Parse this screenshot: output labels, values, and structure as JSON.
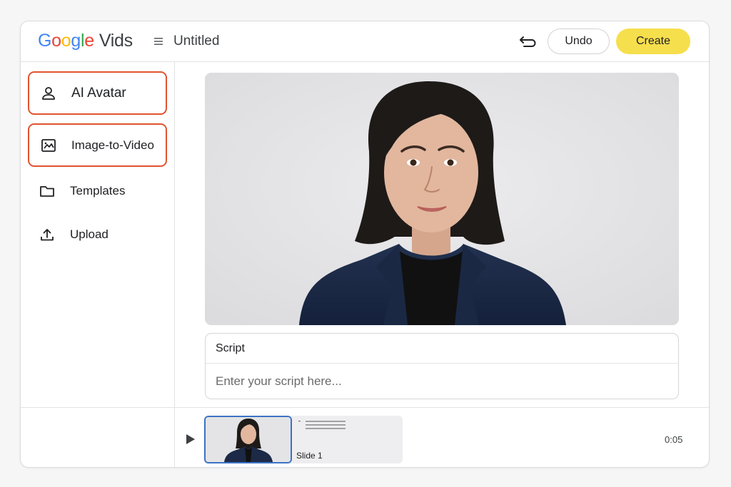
{
  "header": {
    "logo_google": [
      "G",
      "o",
      "o",
      "g",
      "l",
      "e"
    ],
    "logo_product": "Vids",
    "doc_title": "Untitled",
    "undo_label": "Undo",
    "create_label": "Create"
  },
  "sidebar": {
    "items": [
      {
        "label": "AI Avatar",
        "icon": "person-icon",
        "highlighted": true
      },
      {
        "label": "Image-to-Video",
        "icon": "image-icon",
        "highlighted": true
      },
      {
        "label": "Templates",
        "icon": "folder-icon",
        "highlighted": false
      },
      {
        "label": "Upload",
        "icon": "upload-icon",
        "highlighted": false
      }
    ]
  },
  "script": {
    "label": "Script",
    "placeholder": "Enter your script here..."
  },
  "timeline": {
    "slide_label": "Slide 1",
    "duration": "0:05"
  },
  "colors": {
    "highlight_border": "#e0542f",
    "create_button": "#f6df4c",
    "selected_slide_border": "#3b73c6"
  }
}
